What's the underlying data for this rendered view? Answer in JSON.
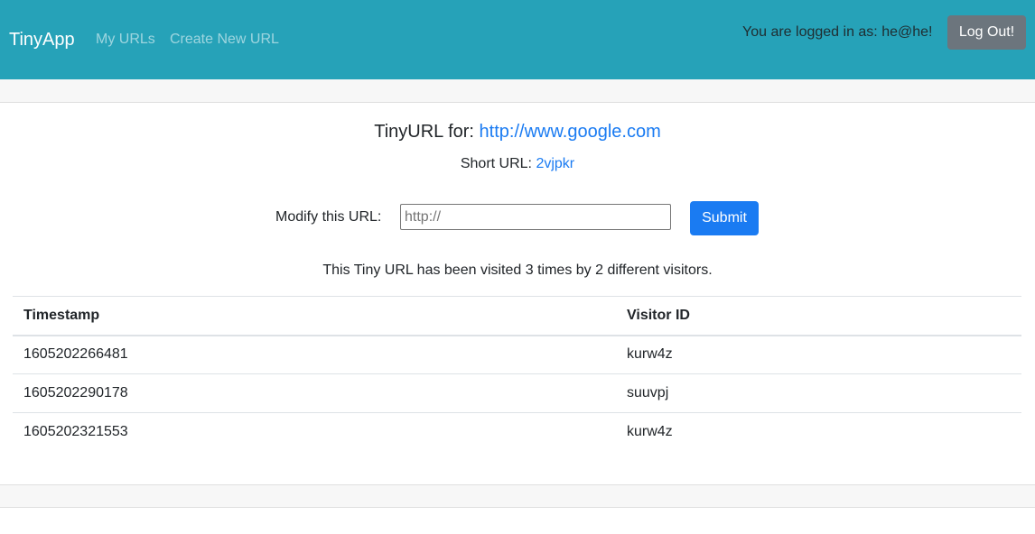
{
  "navbar": {
    "brand": "TinyApp",
    "links": [
      "My URLs",
      "Create New URL"
    ],
    "login_text": "You are logged in as: he@he!",
    "logout_label": "Log Out!"
  },
  "main": {
    "heading_prefix": "TinyURL for: ",
    "long_url": "http://www.google.com",
    "short_url_label": "Short URL: ",
    "short_url": "2vjpkr",
    "modify_label": "Modify this URL:",
    "input_placeholder": "http://",
    "submit_label": "Submit",
    "visits_text": "This Tiny URL has been visited 3 times by 2 different visitors."
  },
  "table": {
    "headers": [
      "Timestamp",
      "Visitor ID"
    ],
    "rows": [
      [
        "1605202266481",
        "kurw4z"
      ],
      [
        "1605202290178",
        "suuvpj"
      ],
      [
        "1605202321553",
        "kurw4z"
      ]
    ]
  },
  "colors": {
    "navbar": "#26a2b8",
    "link": "#1a7bf2",
    "logout_button": "#6c757d",
    "submit_button": "#1a7bf2"
  }
}
